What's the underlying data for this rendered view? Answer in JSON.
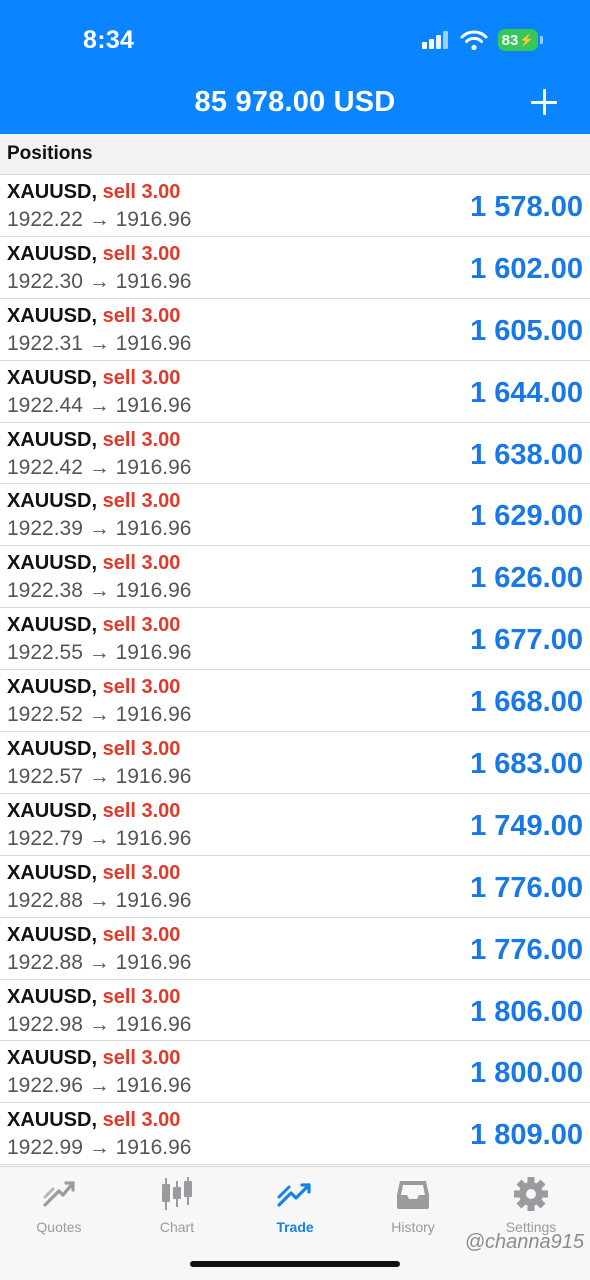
{
  "status_bar": {
    "time": "8:34",
    "battery": "83"
  },
  "header": {
    "balance": "85 978.00 USD"
  },
  "section": {
    "title": "Positions"
  },
  "positions": [
    {
      "symbol": "XAUUSD,",
      "side": "sell 3.00",
      "prices": "1922.22 → 1916.96",
      "profit": "1 578.00"
    },
    {
      "symbol": "XAUUSD,",
      "side": "sell 3.00",
      "prices": "1922.30 → 1916.96",
      "profit": "1 602.00"
    },
    {
      "symbol": "XAUUSD,",
      "side": "sell 3.00",
      "prices": "1922.31 → 1916.96",
      "profit": "1 605.00"
    },
    {
      "symbol": "XAUUSD,",
      "side": "sell 3.00",
      "prices": "1922.44 → 1916.96",
      "profit": "1 644.00"
    },
    {
      "symbol": "XAUUSD,",
      "side": "sell 3.00",
      "prices": "1922.42 → 1916.96",
      "profit": "1 638.00"
    },
    {
      "symbol": "XAUUSD,",
      "side": "sell 3.00",
      "prices": "1922.39 → 1916.96",
      "profit": "1 629.00"
    },
    {
      "symbol": "XAUUSD,",
      "side": "sell 3.00",
      "prices": "1922.38 → 1916.96",
      "profit": "1 626.00"
    },
    {
      "symbol": "XAUUSD,",
      "side": "sell 3.00",
      "prices": "1922.55 → 1916.96",
      "profit": "1 677.00"
    },
    {
      "symbol": "XAUUSD,",
      "side": "sell 3.00",
      "prices": "1922.52 → 1916.96",
      "profit": "1 668.00"
    },
    {
      "symbol": "XAUUSD,",
      "side": "sell 3.00",
      "prices": "1922.57 → 1916.96",
      "profit": "1 683.00"
    },
    {
      "symbol": "XAUUSD,",
      "side": "sell 3.00",
      "prices": "1922.79 → 1916.96",
      "profit": "1 749.00"
    },
    {
      "symbol": "XAUUSD,",
      "side": "sell 3.00",
      "prices": "1922.88 → 1916.96",
      "profit": "1 776.00"
    },
    {
      "symbol": "XAUUSD,",
      "side": "sell 3.00",
      "prices": "1922.88 → 1916.96",
      "profit": "1 776.00"
    },
    {
      "symbol": "XAUUSD,",
      "side": "sell 3.00",
      "prices": "1922.98 → 1916.96",
      "profit": "1 806.00"
    },
    {
      "symbol": "XAUUSD,",
      "side": "sell 3.00",
      "prices": "1922.96 → 1916.96",
      "profit": "1 800.00"
    },
    {
      "symbol": "XAUUSD,",
      "side": "sell 3.00",
      "prices": "1922.99 → 1916.96",
      "profit": "1 809.00"
    }
  ],
  "tabbar": {
    "tabs": [
      {
        "label": "Quotes",
        "icon": "quotes-icon"
      },
      {
        "label": "Chart",
        "icon": "chart-icon"
      },
      {
        "label": "Trade",
        "icon": "trade-icon",
        "active": true
      },
      {
        "label": "History",
        "icon": "history-icon"
      },
      {
        "label": "Settings",
        "icon": "gear-icon"
      }
    ]
  },
  "watermark": "@channa915",
  "colors": {
    "header": "#0b84ff",
    "sell": "#e03a2c",
    "profit": "#1878e6",
    "tab_active": "#1681e8",
    "tab_inactive": "#9a9a9f"
  }
}
